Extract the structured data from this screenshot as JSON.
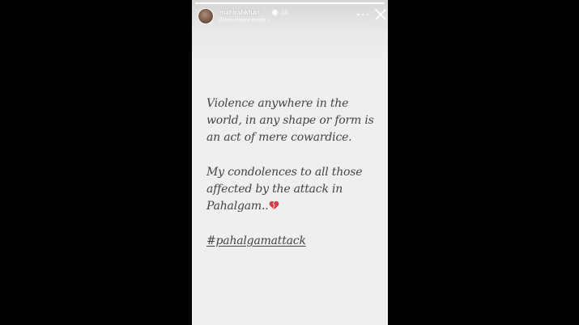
{
  "story": {
    "progress_fraction": 1.0,
    "header": {
      "username": "mahirahkhan",
      "verified_icon": "verified-badge-icon",
      "time_ago": "3h",
      "subtitle": "From create mode",
      "subtitle_chevron": "›",
      "more_icon": "more-dots-icon",
      "close_icon": "close-icon"
    },
    "paragraphs": [
      {
        "lines": [
          "Violence anywhere in the",
          "world, in any shape or form is",
          "an act of mere cowardice."
        ]
      },
      {
        "lines": [
          "My condolences to all those",
          "affected by the attack in",
          "Pahalgam.."
        ],
        "emoji": "broken-heart-icon"
      }
    ],
    "hashtag": "#pahalgamattack"
  },
  "colors": {
    "background": "#000000",
    "story_background": "#efefef",
    "text": "#444444",
    "heart": "#d93a4a"
  }
}
